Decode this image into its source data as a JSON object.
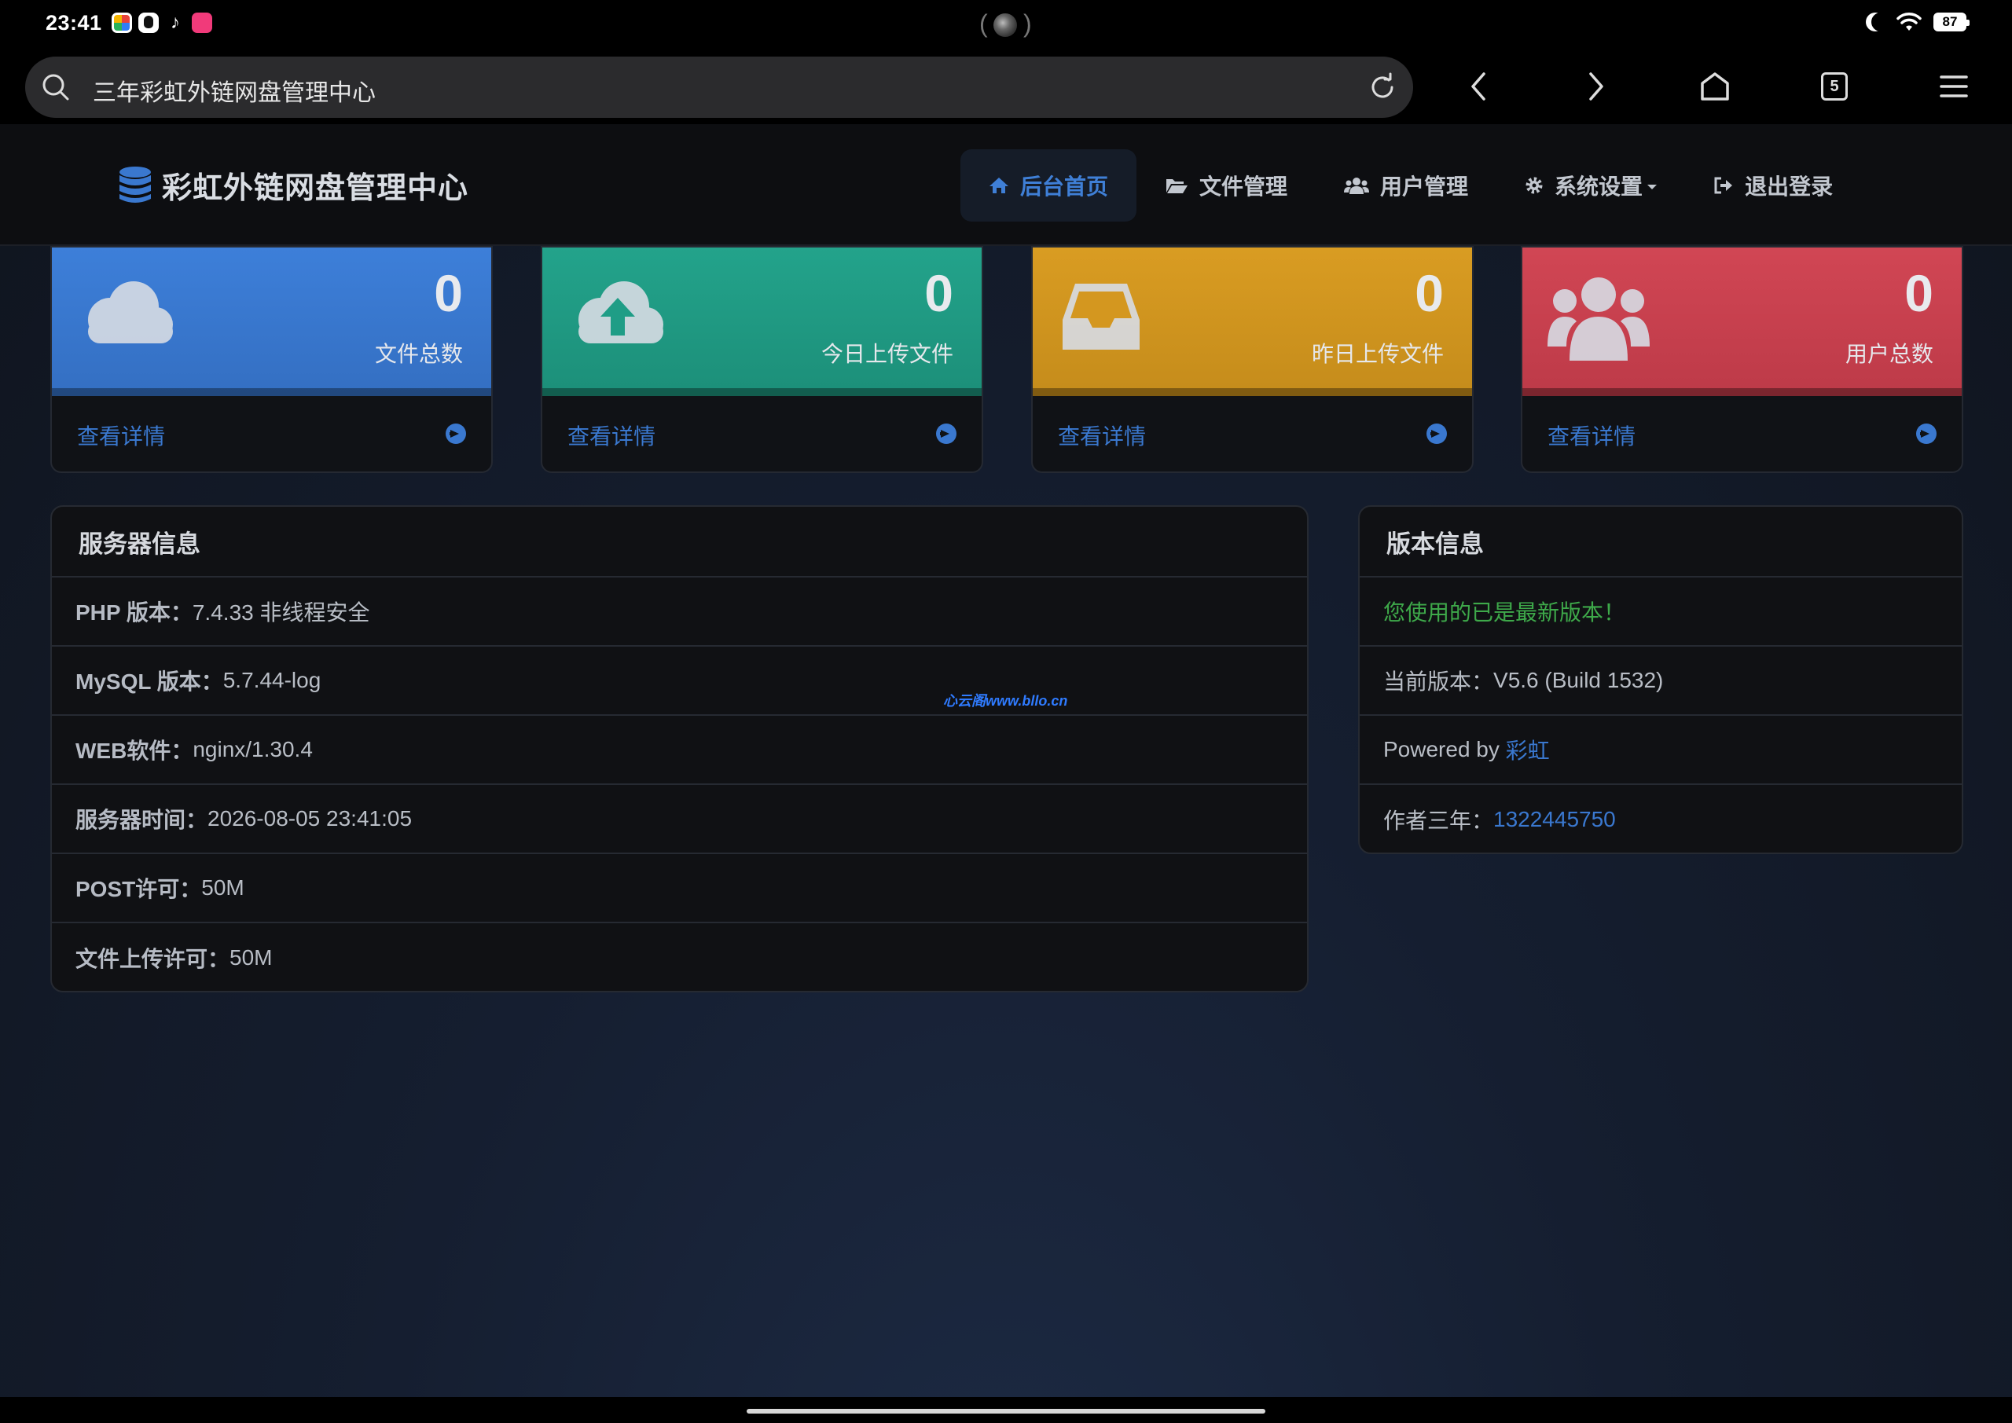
{
  "status_bar": {
    "time": "23:41",
    "battery": "87",
    "icons": [
      "app-icon",
      "qq-icon",
      "tiktok-icon",
      "bilibili-icon",
      "moon-icon",
      "wifi-icon",
      "battery-icon"
    ]
  },
  "browser": {
    "url_text": "三年彩虹外链网盘管理中心",
    "tab_count": "5"
  },
  "navbar": {
    "brand": "彩虹外链网盘管理中心",
    "items": [
      {
        "label": "后台首页",
        "icon": "home-icon",
        "active": true
      },
      {
        "label": "文件管理",
        "icon": "folder-open-icon"
      },
      {
        "label": "用户管理",
        "icon": "users-icon"
      },
      {
        "label": "系统设置",
        "icon": "gear-icon",
        "dropdown": true
      },
      {
        "label": "退出登录",
        "icon": "sign-out-icon"
      }
    ]
  },
  "stats": [
    {
      "value": "0",
      "label": "文件总数",
      "link": "查看详情",
      "icon": "cloud-icon",
      "color": "#3a7bd5"
    },
    {
      "value": "0",
      "label": "今日上传文件",
      "link": "查看详情",
      "icon": "cloud-upload-icon",
      "color": "#1f9d86"
    },
    {
      "value": "0",
      "label": "昨日上传文件",
      "link": "查看详情",
      "icon": "inbox-icon",
      "color": "#d4971f"
    },
    {
      "value": "0",
      "label": "用户总数",
      "link": "查看详情",
      "icon": "users-icon",
      "color": "#c9414f"
    }
  ],
  "server_info": {
    "title": "服务器信息",
    "rows": [
      {
        "key": "PHP 版本：",
        "value": "7.4.33 非线程安全"
      },
      {
        "key": "MySQL 版本：",
        "value": "5.7.44-log"
      },
      {
        "key": "WEB软件：",
        "value": "nginx/1.30.4"
      },
      {
        "key": "服务器时间：",
        "value": "2026-08-05 23:41:05"
      },
      {
        "key": "POST许可：",
        "value": "50M"
      },
      {
        "key": "文件上传许可：",
        "value": "50M"
      }
    ]
  },
  "version_info": {
    "title": "版本信息",
    "latest_notice": "您使用的已是最新版本！",
    "current_version_label": "当前版本：",
    "current_version": "V5.6 (Build 1532)",
    "powered_by_label": "Powered by ",
    "powered_by": "彩虹",
    "author_label": "作者三年：",
    "author_qq": "1322445750"
  },
  "watermark": "心云阁www.bllo.cn",
  "colors": {
    "accent": "#3a78cf",
    "success": "#3ea94a",
    "card_blue": "#3a7bd5",
    "card_green": "#1f9d86",
    "card_orange": "#d4971f",
    "card_red": "#c9414f"
  }
}
